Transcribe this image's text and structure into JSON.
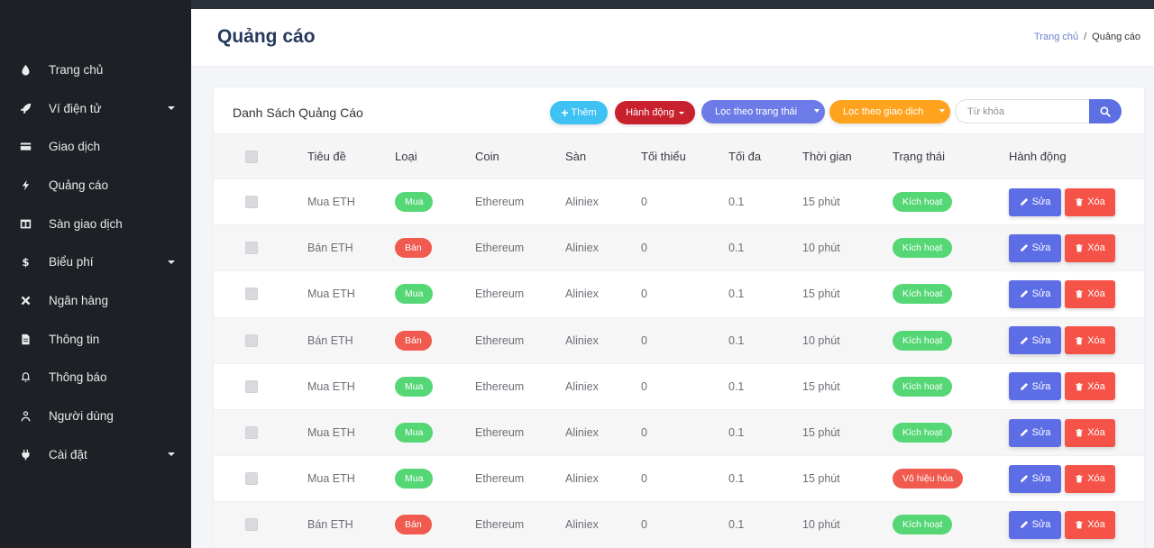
{
  "colors": {
    "sidebar": "#1d2125",
    "accent": "#5d6de6",
    "success": "#55d776",
    "danger": "#f05a4f",
    "warning": "#ffa31f",
    "info": "#3ec2f3"
  },
  "sidebar": {
    "items": [
      {
        "label": "Trang chủ",
        "icon": "drop-icon",
        "has_submenu": false
      },
      {
        "label": "Ví điện tử",
        "icon": "rocket-icon",
        "has_submenu": true
      },
      {
        "label": "Giao dịch",
        "icon": "card-icon",
        "has_submenu": false
      },
      {
        "label": "Quảng cáo",
        "icon": "bolt-icon",
        "has_submenu": false
      },
      {
        "label": "Sàn giao dịch",
        "icon": "columns-icon",
        "has_submenu": false
      },
      {
        "label": "Biểu phí",
        "icon": "dollar-icon",
        "has_submenu": true
      },
      {
        "label": "Ngân hàng",
        "icon": "tools-icon",
        "has_submenu": false
      },
      {
        "label": "Thông tin",
        "icon": "document-icon",
        "has_submenu": false
      },
      {
        "label": "Thông báo",
        "icon": "bell-icon",
        "has_submenu": false
      },
      {
        "label": "Người dùng",
        "icon": "user-icon",
        "has_submenu": false
      },
      {
        "label": "Cài đặt",
        "icon": "plug-icon",
        "has_submenu": true
      }
    ]
  },
  "header": {
    "title": "Quảng cáo",
    "breadcrumb": {
      "link": "Trang chủ",
      "separator": "/",
      "current": "Quảng cáo"
    }
  },
  "card": {
    "title": "Danh Sách Quảng Cáo",
    "add_label": "Thêm",
    "action_label": "Hành động",
    "filter_status_label": "Lọc theo trạng thái",
    "filter_trade_label": "Lọc theo giao dịch",
    "search_placeholder": "Từ khóa"
  },
  "table": {
    "headers": {
      "title": "Tiêu đề",
      "type": "Loại",
      "coin": "Coin",
      "exchange": "Sàn",
      "min": "Tối thiểu",
      "max": "Tối đa",
      "time": "Thời gian",
      "status": "Trạng thái",
      "actions": "Hành động"
    },
    "edit_label": "Sửa",
    "delete_label": "Xóa",
    "rows": [
      {
        "title": "Mua ETH",
        "type": "Mua",
        "type_kind": "buy",
        "coin": "Ethereum",
        "exchange": "Aliniex",
        "min": "0",
        "max": "0.1",
        "time": "15 phút",
        "status": "Kích hoạt",
        "status_kind": "active"
      },
      {
        "title": "Bán ETH",
        "type": "Bán",
        "type_kind": "sell",
        "coin": "Ethereum",
        "exchange": "Aliniex",
        "min": "0",
        "max": "0.1",
        "time": "10 phút",
        "status": "Kích hoạt",
        "status_kind": "active"
      },
      {
        "title": "Mua ETH",
        "type": "Mua",
        "type_kind": "buy",
        "coin": "Ethereum",
        "exchange": "Aliniex",
        "min": "0",
        "max": "0.1",
        "time": "15 phút",
        "status": "Kích hoạt",
        "status_kind": "active"
      },
      {
        "title": "Bán ETH",
        "type": "Bán",
        "type_kind": "sell",
        "coin": "Ethereum",
        "exchange": "Aliniex",
        "min": "0",
        "max": "0.1",
        "time": "10 phút",
        "status": "Kích hoạt",
        "status_kind": "active"
      },
      {
        "title": "Mua ETH",
        "type": "Mua",
        "type_kind": "buy",
        "coin": "Ethereum",
        "exchange": "Aliniex",
        "min": "0",
        "max": "0.1",
        "time": "15 phút",
        "status": "Kích hoạt",
        "status_kind": "active"
      },
      {
        "title": "Mua ETH",
        "type": "Mua",
        "type_kind": "buy",
        "coin": "Ethereum",
        "exchange": "Aliniex",
        "min": "0",
        "max": "0.1",
        "time": "15 phút",
        "status": "Kích hoạt",
        "status_kind": "active"
      },
      {
        "title": "Mua ETH",
        "type": "Mua",
        "type_kind": "buy",
        "coin": "Ethereum",
        "exchange": "Aliniex",
        "min": "0",
        "max": "0.1",
        "time": "15 phút",
        "status": "Vô hiệu hóa",
        "status_kind": "inactive"
      },
      {
        "title": "Bán ETH",
        "type": "Bán",
        "type_kind": "sell",
        "coin": "Ethereum",
        "exchange": "Aliniex",
        "min": "0",
        "max": "0.1",
        "time": "10 phút",
        "status": "Kích hoạt",
        "status_kind": "active"
      }
    ]
  }
}
